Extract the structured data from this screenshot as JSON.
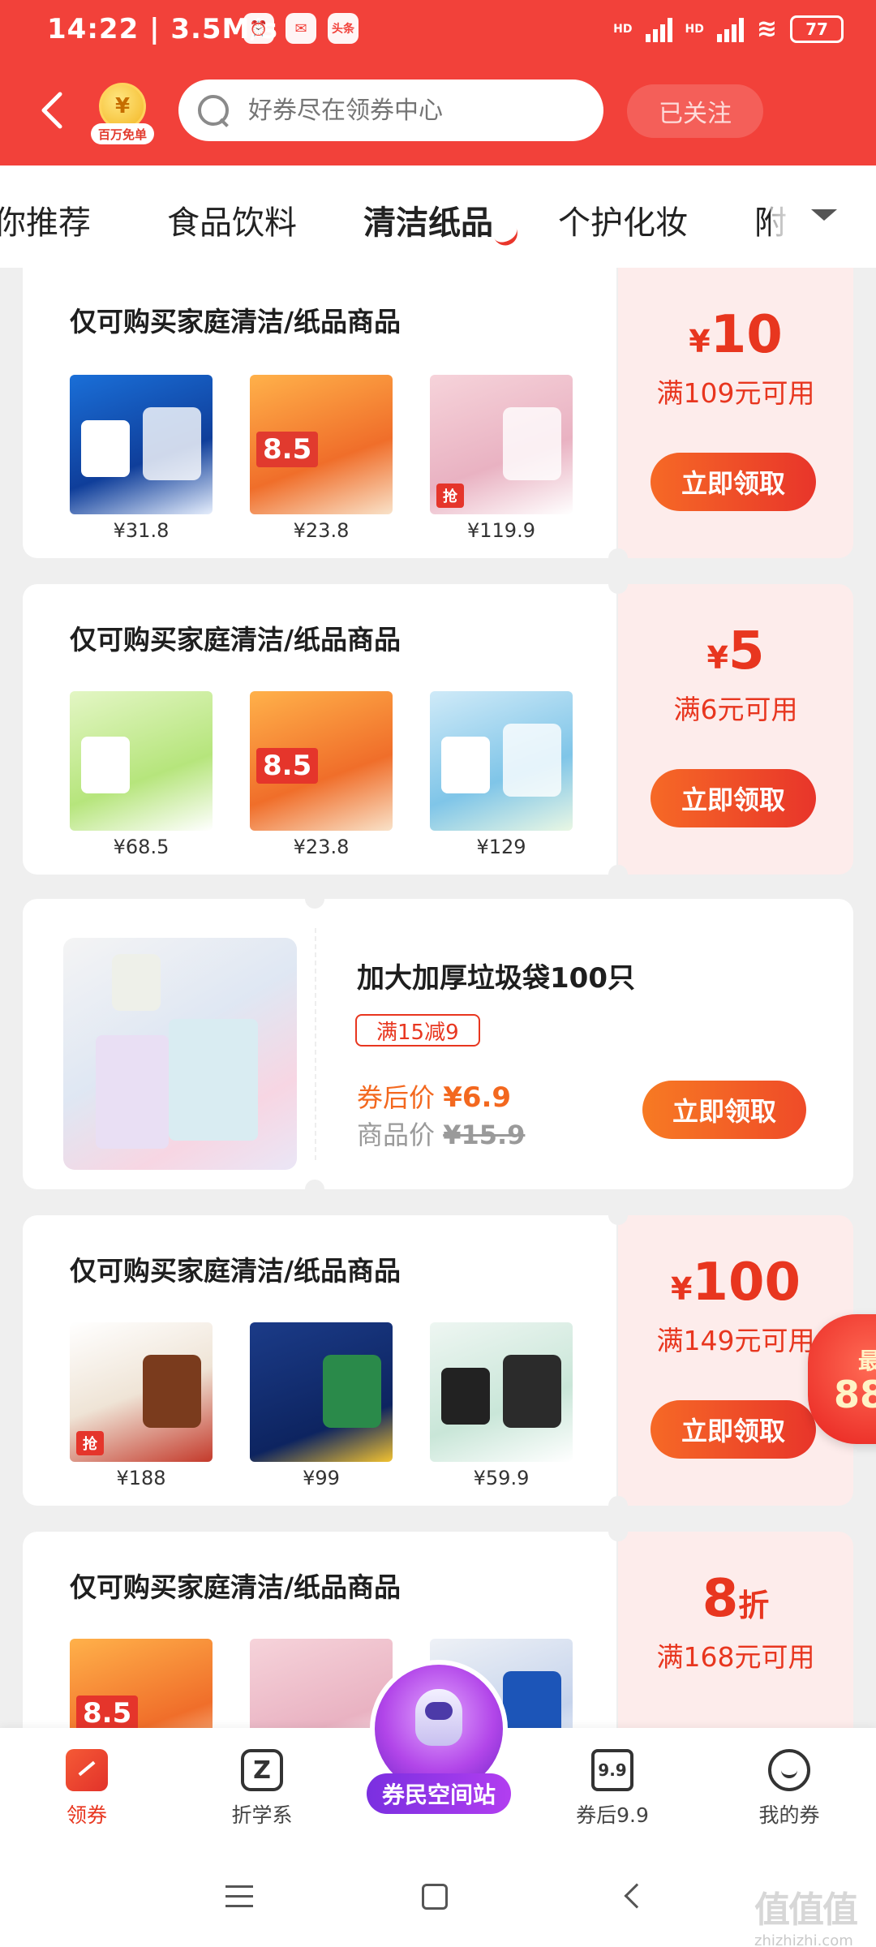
{
  "status_bar": {
    "time": "14:22 | 3.5M/s",
    "app_badge": "头条",
    "battery": "77",
    "net1": "HD",
    "net2": "HD"
  },
  "header": {
    "logo_text": "百万免单",
    "logo_glyph": "¥",
    "search_placeholder": "好券尽在领券中心",
    "follow_label": "已关注"
  },
  "tabs": [
    {
      "label": "你推荐"
    },
    {
      "label": "食品饮料"
    },
    {
      "label": "清洁纸品",
      "active": true
    },
    {
      "label": "个护化妆"
    },
    {
      "label": "附"
    }
  ],
  "coupons": [
    {
      "title": "仅可购买家庭清洁/纸品商品",
      "amount_prefix": "¥",
      "amount": "10",
      "condition": "满109元可用",
      "button": "立即领取",
      "products": [
        {
          "price": "¥31.8",
          "tag": ""
        },
        {
          "price": "¥23.8",
          "tag": "8.5"
        },
        {
          "price": "¥119.9",
          "tag": "抢"
        }
      ]
    },
    {
      "title": "仅可购买家庭清洁/纸品商品",
      "amount_prefix": "¥",
      "amount": "5",
      "condition": "满6元可用",
      "button": "立即领取",
      "products": [
        {
          "price": "¥68.5",
          "tag": ""
        },
        {
          "price": "¥23.8",
          "tag": "8.5"
        },
        {
          "price": "¥129",
          "tag": ""
        }
      ]
    },
    {
      "title": "仅可购买家庭清洁/纸品商品",
      "amount_prefix": "¥",
      "amount": "100",
      "condition": "满149元可用",
      "button": "立即领取",
      "products": [
        {
          "price": "¥188",
          "tag": "抢"
        },
        {
          "price": "¥99",
          "tag": ""
        },
        {
          "price": "¥59.9",
          "tag": ""
        }
      ]
    },
    {
      "title": "仅可购买家庭清洁/纸品商品",
      "amount_prefix": "",
      "amount": "8",
      "amount_suffix": "折",
      "condition": "满168元可用",
      "products": [
        {
          "price": "",
          "tag": "8.5"
        },
        {
          "price": "",
          "tag": ""
        },
        {
          "price": "",
          "tag": ""
        }
      ]
    }
  ],
  "product_card": {
    "name": "加大加厚垃圾袋100只",
    "promo_tag": "满15减9",
    "after_label": "券后价 ",
    "after_price": "¥6.9",
    "orig_label": "商品价 ",
    "orig_price": "¥15.9",
    "button": "立即领取"
  },
  "floating_packet": {
    "line1": "最",
    "line2": "88"
  },
  "bottom_nav": {
    "items": [
      {
        "label": "领券",
        "active": true
      },
      {
        "label": "折学系"
      },
      {
        "label": "券后9.9",
        "icon_text": "9.9"
      },
      {
        "label": "我的券"
      }
    ],
    "center_label": "券民空间站",
    "z_glyph": "Z"
  },
  "watermark": {
    "main": "值值值",
    "sub": "zhizhizhi.com"
  },
  "colors": {
    "brand_red": "#f2413a",
    "accent_orange": "#f3681f",
    "purple": "#9b3be8"
  }
}
